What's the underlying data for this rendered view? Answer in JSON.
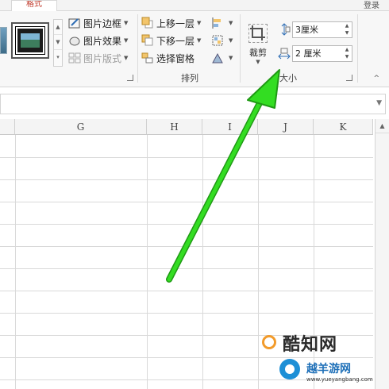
{
  "ribbon": {
    "active_tab": "格式",
    "login_label": "登录",
    "picture_styles": {
      "border_label": "图片边框",
      "effects_label": "图片效果",
      "layout_label": "图片版式"
    },
    "arrange": {
      "bring_forward_label": "上移一层",
      "send_backward_label": "下移一层",
      "selection_pane_label": "选择窗格",
      "group_label": "排列"
    },
    "size": {
      "crop_label": "裁剪",
      "height_value": "3厘米",
      "width_value": "2 厘米",
      "group_label": "大小"
    }
  },
  "sheet": {
    "columns": [
      "G",
      "H",
      "I",
      "J",
      "K"
    ]
  },
  "watermark": {
    "line1": "酷知网",
    "line2": "越羊游网",
    "line3": "www.yueyangbang.com"
  },
  "colors": {
    "arrow": "#33dd22",
    "active_tab_text": "#c0392b"
  },
  "icons": [
    "picture-border-icon",
    "picture-effects-icon",
    "picture-layout-icon",
    "bring-forward-icon",
    "send-backward-icon",
    "selection-pane-icon",
    "align-icon",
    "group-icon",
    "rotate-icon",
    "crop-icon",
    "height-icon",
    "width-icon"
  ]
}
